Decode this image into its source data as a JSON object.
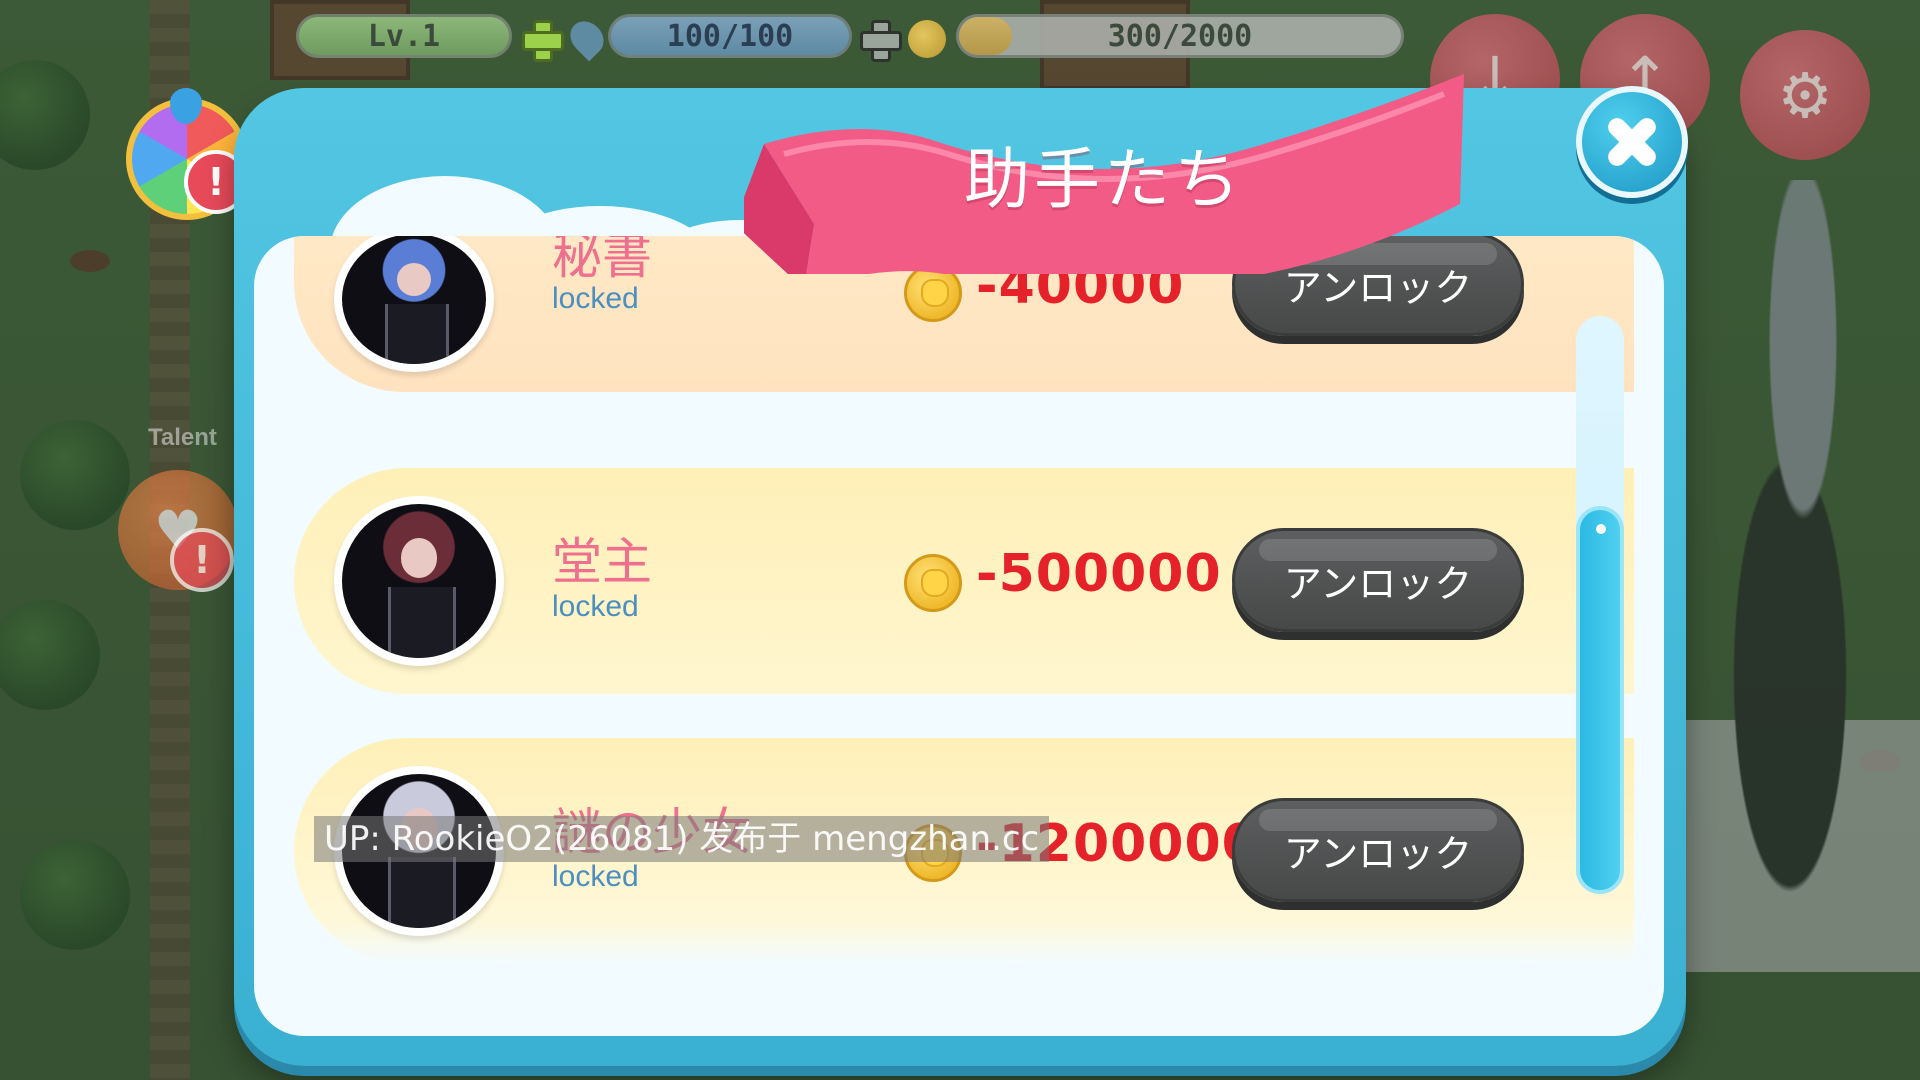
{
  "hud": {
    "level": "Lv.1",
    "energy": "100/100",
    "gold": "300/2000",
    "gold_fill": 0.06
  },
  "side": {
    "talent_label": "Talent",
    "alert_glyph": "!"
  },
  "modal": {
    "title": "助手たち"
  },
  "assistants": [
    {
      "name": "秘書",
      "status": "locked",
      "price": "-40000",
      "button": "アンロック"
    },
    {
      "name": "堂主",
      "status": "locked",
      "price": "-500000",
      "button": "アンロック"
    },
    {
      "name": "謎の少女",
      "status": "locked",
      "price": "-1200000",
      "button": "アンロック"
    }
  ],
  "watermark": "UP: RookieO2(26081) 发布于 mengzhan.cc",
  "colors": {
    "modal_frame": "#3ab0d2",
    "banner": "#f25b86",
    "price_red": "#e5212a",
    "name_pink": "#ee6f8e",
    "status_blue": "#4b8ec0",
    "unlock_button": "#474848"
  },
  "icons": [
    "wheel-icon",
    "alert-icon",
    "plus-icon",
    "drop-icon",
    "coin-icon",
    "download-icon",
    "upgrade-icon",
    "gear-icon",
    "heart-icon",
    "close-icon"
  ]
}
